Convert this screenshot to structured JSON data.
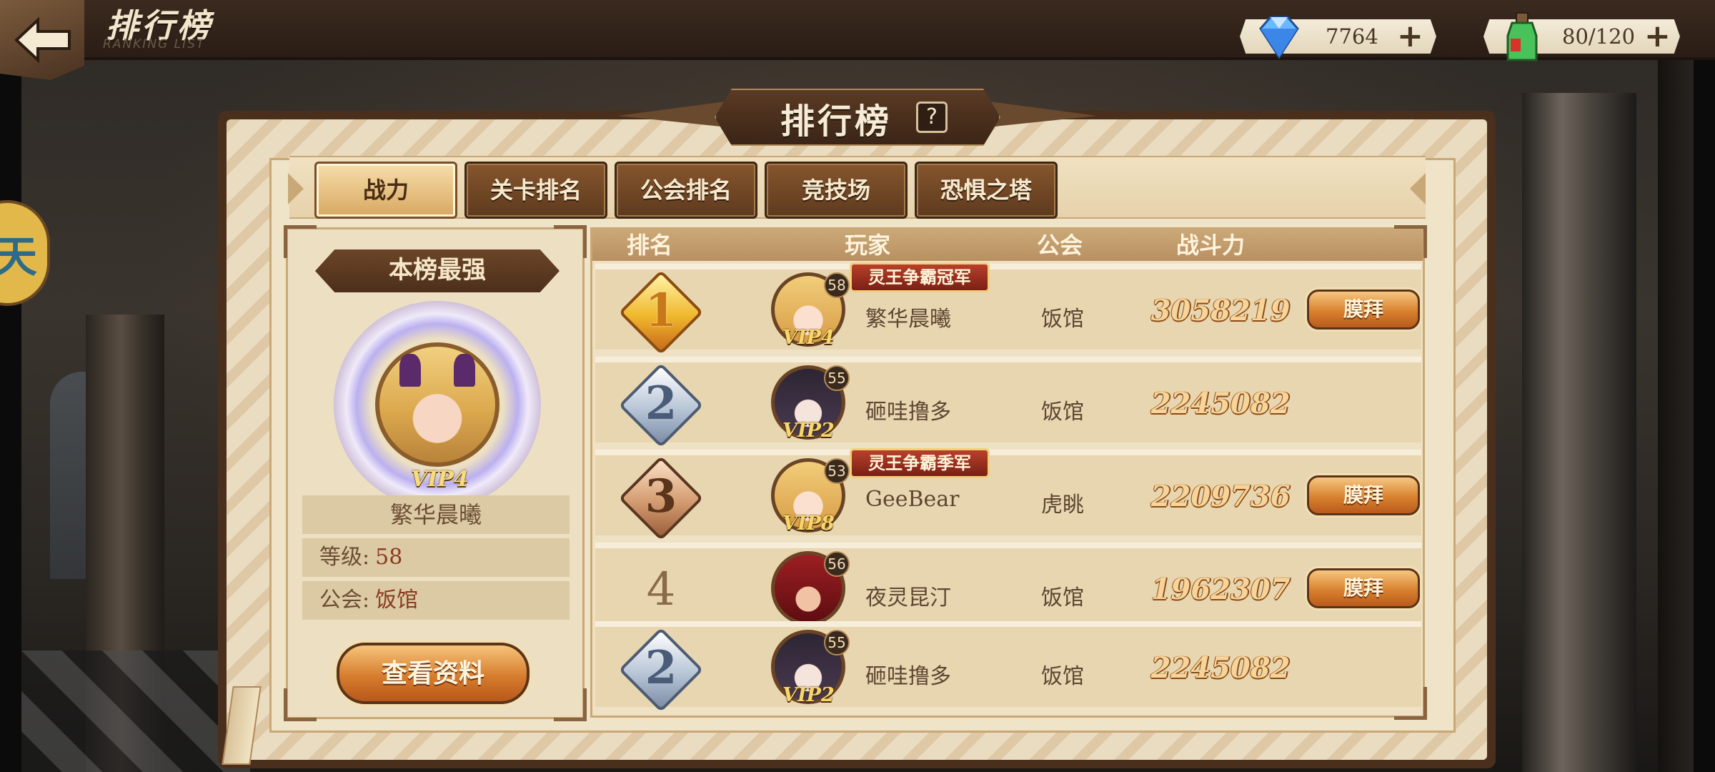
{
  "header": {
    "title": "排行榜",
    "subtitle": "RANKING LIST"
  },
  "resources": {
    "gems": "7764",
    "stamina": "80/120",
    "plus": "+"
  },
  "side_chip": {
    "glyph": "天"
  },
  "panel": {
    "title": "排行榜",
    "help": "?"
  },
  "tabs": [
    {
      "label": "战力",
      "active": true
    },
    {
      "label": "关卡排名",
      "active": false
    },
    {
      "label": "公会排名",
      "active": false
    },
    {
      "label": "竞技场",
      "active": false
    },
    {
      "label": "恐惧之塔",
      "active": false
    }
  ],
  "champion": {
    "heading": "本榜最强",
    "vip": "VIP4",
    "name": "繁华晨曦",
    "level_label": "等级:",
    "level_value": "58",
    "guild_label": "公会:",
    "guild_value": "饭馆",
    "view_button": "查看资料"
  },
  "table": {
    "headers": {
      "rank": "排名",
      "player": "玩家",
      "guild": "公会",
      "power": "战斗力"
    },
    "rows": [
      {
        "rank": "1",
        "badge": "gold",
        "level": "58",
        "vip": "VIP4",
        "title": "灵王争霸冠军",
        "name": "繁华晨曦",
        "guild": "饭馆",
        "power": "3058219",
        "action": "膜拜"
      },
      {
        "rank": "2",
        "badge": "silver",
        "level": "55",
        "vip": "VIP2",
        "title": "",
        "name": "砸哇撸多",
        "guild": "饭馆",
        "power": "2245082",
        "action": ""
      },
      {
        "rank": "3",
        "badge": "bronze",
        "level": "53",
        "vip": "VIP8",
        "title": "灵王争霸季军",
        "name": "GeeBear",
        "guild": "虎眺",
        "power": "2209736",
        "action": "膜拜"
      },
      {
        "rank": "4",
        "badge": "plain",
        "level": "56",
        "vip": "",
        "title": "",
        "name": "夜灵昆汀",
        "guild": "饭馆",
        "power": "1962307",
        "action": "膜拜"
      },
      {
        "rank": "2",
        "badge": "silver",
        "level": "55",
        "vip": "VIP2",
        "title": "",
        "name": "砸哇撸多",
        "guild": "饭馆",
        "power": "2245082",
        "action": ""
      }
    ]
  }
}
